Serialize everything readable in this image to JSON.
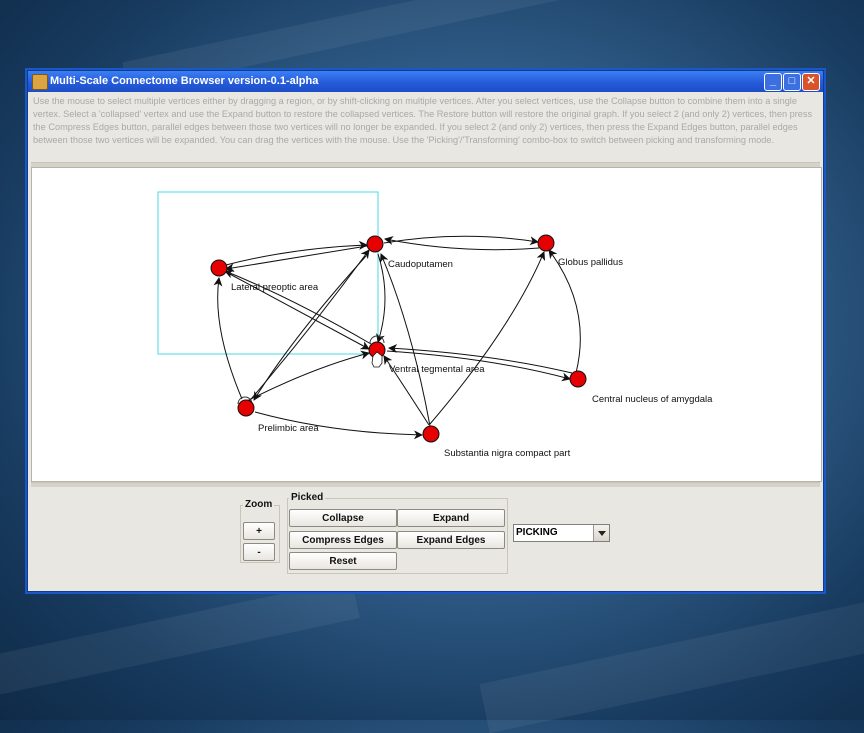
{
  "window": {
    "title": "Multi-Scale Connectome Browser version-0.1-alpha",
    "instructions": "Use the mouse to select multiple vertices either by dragging a region, or by shift-clicking on multiple vertices. After you select vertices, use the Collapse button to combine them into a single vertex.  Select a 'collapsed' vertex and use the Expand button to restore the collapsed vertices.  The Restore button will restore the original graph.  If you select 2 (and only 2) vertices, then press the Compress Edges button, parallel edges between those two vertices will no longer be expanded.  If you select 2 (and only 2) vertices, then press the Expand Edges button, parallel edges between those two vertices will be expanded.  You can drag the vertices with the mouse. Use the 'Picking'/'Transforming' combo-box to switch between picking and transforming mode."
  },
  "graph": {
    "nodes": [
      {
        "id": "caudoputamen",
        "label": "Caudoputamen"
      },
      {
        "id": "globus",
        "label": "Globus pallidus"
      },
      {
        "id": "lpa",
        "label": "Lateral preoptic area"
      },
      {
        "id": "vta",
        "label": "Ventral tegmental area"
      },
      {
        "id": "cna",
        "label": "Central nucleus of amygdala"
      },
      {
        "id": "prelimbic",
        "label": "Prelimbic area"
      },
      {
        "id": "snc",
        "label": "Substantia nigra compact part"
      }
    ],
    "node_color": "#e60000",
    "selection_color": "#66e0e8"
  },
  "zoom": {
    "title": "Zoom",
    "plus_label": "+",
    "minus_label": "-"
  },
  "picked": {
    "title": "Picked",
    "collapse_label": "Collapse",
    "expand_label": "Expand",
    "compress_label": "Compress Edges",
    "expand_edges_label": "Expand Edges",
    "reset_label": "Reset"
  },
  "mode": {
    "selected": "PICKING"
  }
}
